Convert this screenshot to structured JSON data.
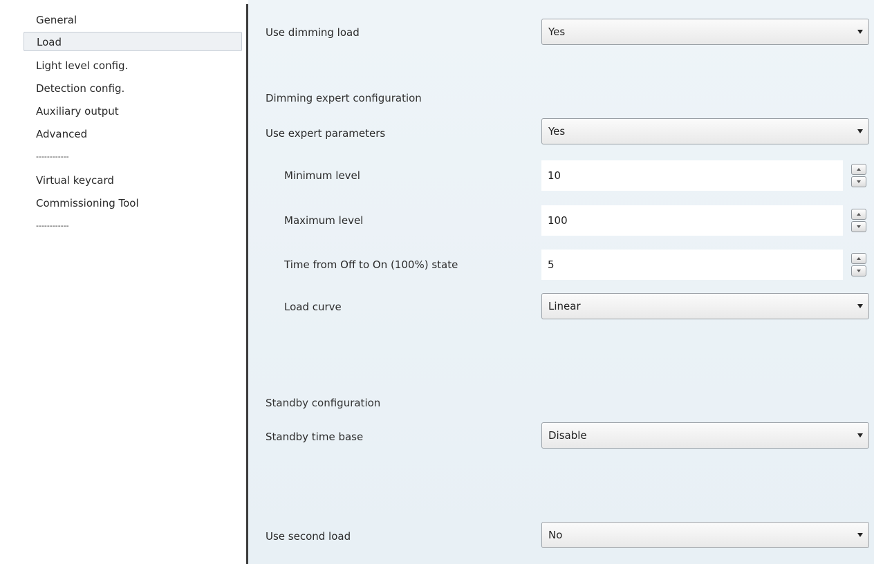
{
  "sidebar": {
    "items": [
      {
        "label": "General"
      },
      {
        "label": "Load"
      },
      {
        "label": "Light level config."
      },
      {
        "label": "Detection config."
      },
      {
        "label": "Auxiliary output"
      },
      {
        "label": "Advanced"
      },
      {
        "label": "------------"
      },
      {
        "label": "Virtual keycard"
      },
      {
        "label": "Commissioning Tool"
      },
      {
        "label": "------------"
      }
    ],
    "selected_index": 1
  },
  "main": {
    "use_dimming_load": {
      "label": "Use dimming load",
      "value": "Yes"
    },
    "dimming_section_title": "Dimming expert configuration",
    "use_expert_parameters": {
      "label": "Use expert parameters",
      "value": "Yes"
    },
    "minimum_level": {
      "label": "Minimum level",
      "value": "10"
    },
    "maximum_level": {
      "label": "Maximum level",
      "value": "100"
    },
    "time_off_to_on": {
      "label": "Time from Off to On (100%) state",
      "value": "5"
    },
    "load_curve": {
      "label": "Load curve",
      "value": "Linear"
    },
    "standby_section_title": "Standby configuration",
    "standby_time_base": {
      "label": "Standby time base",
      "value": "Disable"
    },
    "use_second_load": {
      "label": "Use second load",
      "value": "No"
    }
  },
  "icons": {
    "dropdown": "chevron-down-icon",
    "spin_up": "spin-up-icon",
    "spin_down": "spin-down-icon"
  },
  "colors": {
    "panel_bg": "#e8f0f5",
    "splitter": "#3c3c3c",
    "selected_item_bg": "#eef1f4"
  }
}
